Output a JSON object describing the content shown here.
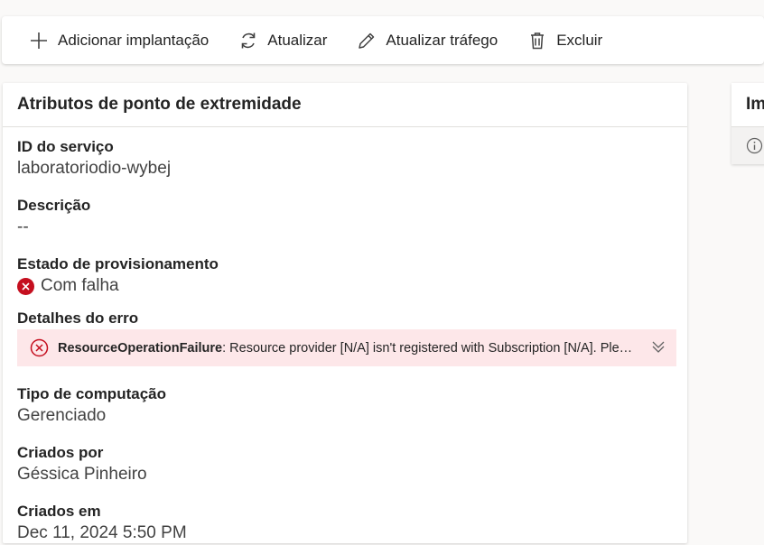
{
  "toolbar": {
    "add_deployment_label": "Adicionar implantação",
    "refresh_label": "Atualizar",
    "update_traffic_label": "Atualizar tráfego",
    "delete_label": "Excluir"
  },
  "attributes_card": {
    "title": "Atributos de ponto de extremidade",
    "service_id_label": "ID do serviço",
    "service_id_value": "laboratoriodio-wybej",
    "description_label": "Descrição",
    "description_value": "--",
    "provisioning_state_label": "Estado de provisionamento",
    "provisioning_state_value": "Com falha",
    "error_details_label": "Detalhes do erro",
    "error_code": "ResourceOperationFailure",
    "error_message": ": Resource provider [N/A] isn't registered with Subscription [N/A]. Please see troubleshooting guide.",
    "compute_type_label": "Tipo de computação",
    "compute_type_value": "Gerenciado",
    "created_by_label": "Criados por",
    "created_by_value": "Géssica Pinheiro",
    "created_on_label": "Criados em",
    "created_on_value": "Dec 11, 2024 5:50 PM"
  },
  "side_card": {
    "title": "Im"
  },
  "icons": {
    "add": "plus-icon",
    "refresh": "refresh-icon",
    "update_traffic": "pencil-icon",
    "delete": "trash-icon",
    "status": "error-circle-icon",
    "error": "error-circle-outline-icon",
    "expand": "chevron-double-down-icon",
    "info": "info-icon"
  },
  "colors": {
    "error_red": "#c50f1f",
    "error_background": "#fde7e9"
  }
}
